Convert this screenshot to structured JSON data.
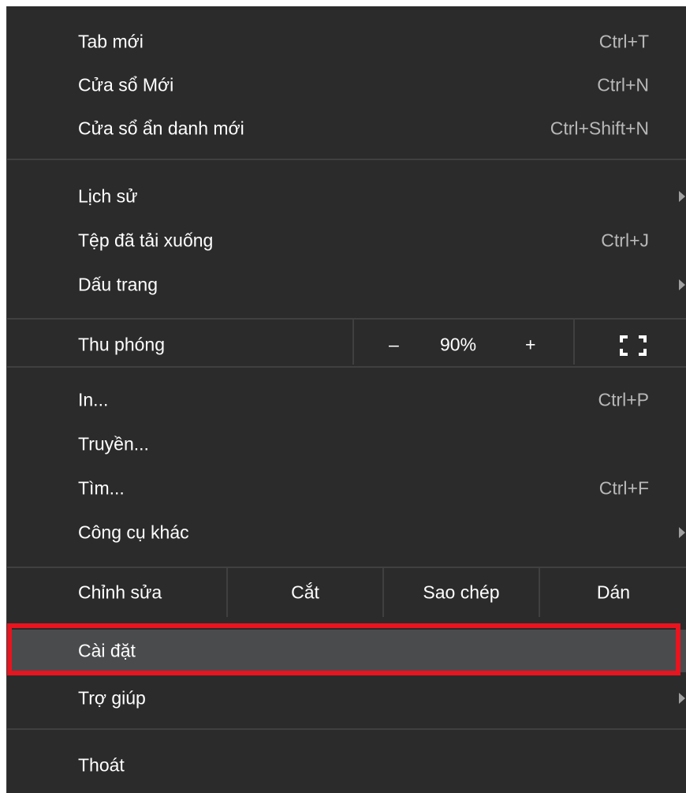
{
  "menu": {
    "section1": [
      {
        "label": "Tab mới",
        "shortcut": "Ctrl+T"
      },
      {
        "label": "Cửa sổ Mới",
        "shortcut": "Ctrl+N"
      },
      {
        "label": "Cửa sổ ẩn danh mới",
        "shortcut": "Ctrl+Shift+N"
      }
    ],
    "section2": [
      {
        "label": "Lịch sử",
        "shortcut": ""
      },
      {
        "label": "Tệp đã tải xuống",
        "shortcut": "Ctrl+J"
      },
      {
        "label": "Dấu trang",
        "shortcut": ""
      }
    ],
    "zoom": {
      "label": "Thu phóng",
      "minus": "–",
      "value": "90%",
      "plus": "+"
    },
    "section3": [
      {
        "label": "In...",
        "shortcut": "Ctrl+P"
      },
      {
        "label": "Truyền...",
        "shortcut": ""
      },
      {
        "label": "Tìm...",
        "shortcut": "Ctrl+F"
      },
      {
        "label": "Công cụ khác",
        "shortcut": ""
      }
    ],
    "edit": {
      "label": "Chỉnh sửa",
      "cut": "Cắt",
      "copy": "Sao chép",
      "paste": "Dán"
    },
    "section4": [
      {
        "label": "Cài đặt"
      },
      {
        "label": "Trợ giúp"
      }
    ],
    "exit": {
      "label": "Thoát"
    }
  },
  "colors": {
    "background": "#2b2b2b",
    "highlight": "#4a4b4d",
    "annotation": "#e8141f",
    "separator": "#404040"
  },
  "icons": {
    "submenu": "chevron-right-icon",
    "fullscreen": "fullscreen-icon"
  }
}
